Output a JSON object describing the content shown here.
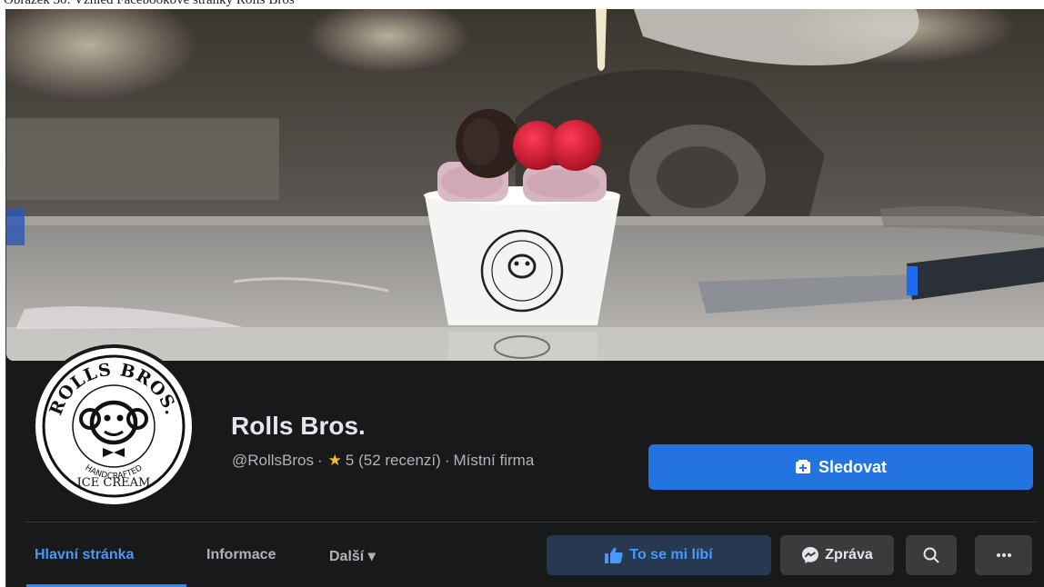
{
  "caption": "Obrázek 30: Vzhled Facebookové stránky Rolls Bros",
  "page": {
    "name": "Rolls Bros.",
    "handle": "@RollsBros",
    "separator": "·",
    "rating": "5 (52 recenzí)",
    "category": "Místní firma"
  },
  "logo": {
    "top_text": "ROLLS BROS.",
    "bottom_text": "HANDCRAFTED",
    "sub_text": "ICE CREAM"
  },
  "actions": {
    "follow": "Sledovat",
    "like": "To se mi líbí",
    "message": "Zpráva"
  },
  "tabs": [
    {
      "label": "Hlavní stránka",
      "active": true
    },
    {
      "label": "Informace",
      "active": false
    },
    {
      "label": "Další ▾",
      "active": false
    }
  ],
  "icons": {
    "follow": "follow-icon",
    "like": "thumbs-up-icon",
    "message": "messenger-icon",
    "search": "search-icon",
    "more": "more-icon",
    "rating": "star-icon"
  },
  "colors": {
    "background": "#18191a",
    "primary": "#2374e1",
    "like_bg": "#263951",
    "like_text": "#4599ff",
    "secondary_button": "#3a3b3c",
    "active_tab": "#4a97f0",
    "star": "#f7b928"
  }
}
